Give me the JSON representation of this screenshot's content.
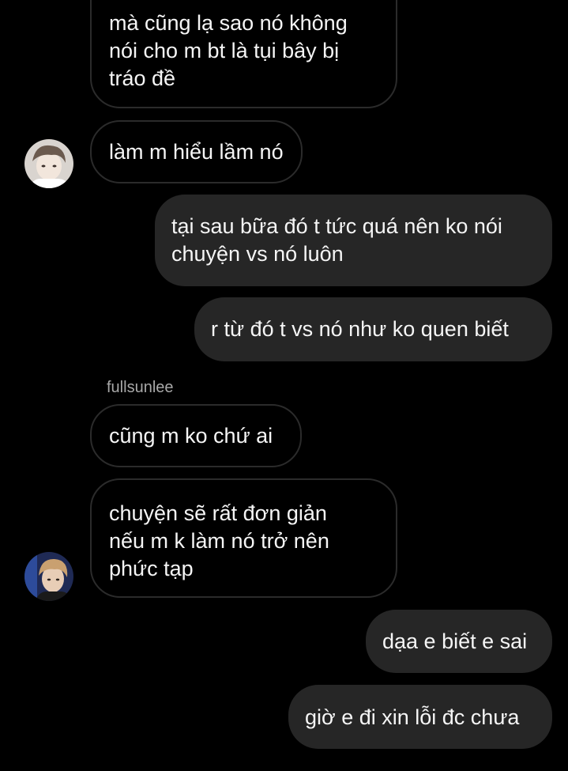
{
  "messages": [
    {
      "text": "mà cũng lạ sao nó không\nnói cho m bt là tụi bây bị\ntráo đề"
    },
    {
      "text": "làm m hiểu lầm nó"
    },
    {
      "text": "tại sau bữa đó t tức quá nên ko nói\nchuyện vs nó luôn"
    },
    {
      "text": "r từ đó t vs nó như ko quen biết"
    },
    {
      "sender": "fullsunlee",
      "text": "cũng m ko chứ ai"
    },
    {
      "text": "chuyện sẽ rất đơn giản\nnếu m k làm nó trở nên\nphức tạp"
    },
    {
      "text": "dạa e biết e sai"
    },
    {
      "text": "giờ e đi xin lỗi đc chưa"
    }
  ]
}
